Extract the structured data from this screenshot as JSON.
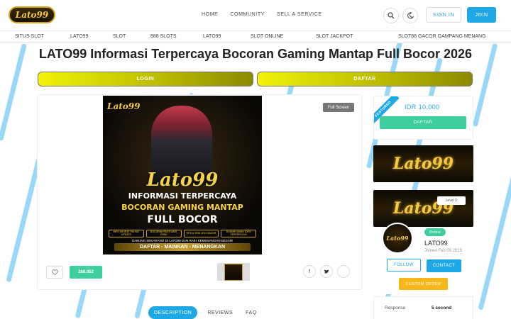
{
  "header": {
    "logo_text": "Lato99",
    "nav": [
      "HOME",
      "COMMUNITY",
      "SELL A SERVICE"
    ],
    "search_icon": "search-icon",
    "theme_icon": "moon-icon",
    "signin_label": "SIGN IN",
    "join_label": "JOIN"
  },
  "subnav": [
    "SITUS SLOT",
    "LATO99",
    "SLOT",
    "888 SLOTS",
    "LATO99",
    "SLOT ONLINE",
    "SLOT JACKPOT",
    "SLOT88 GACOR GAMPANG MENANG"
  ],
  "page_title": "LATO99 Informasi Terpercaya Bocoran Gaming Mantap Full Bocor 2026",
  "buttons": {
    "login": "LOGIN",
    "daftar": "DAFTAR"
  },
  "banner": {
    "logo": "Lato99",
    "big": "Lato99",
    "line1": "INFORMASI TERPERCAYA",
    "line2": "BOCORAN GAMING MANTAP",
    "line3": "FULL BOCOR",
    "features": [
      "INFO AKURAT PALING UPDATE",
      "BOCORAN PASTI ANTI ZONK",
      "TIPS & TRIK JITU GACOR",
      "DIJAMIN AMAN 100% TERPERCAYA"
    ],
    "sub": "GABUNG SEKARANG DI LATO99 DAN RAIH KEMENANGAN BESAR!",
    "cta": "DAFTAR - MAINKAN - MENANGKAN"
  },
  "fullscreen_label": "Full Screen",
  "likes_count": "268.652",
  "tabs": [
    "DESCRIPTION",
    "REVIEWS",
    "FAQ"
  ],
  "sidebar": {
    "ribbon": "FEATURED",
    "price": "IDR 10.000",
    "daftar_label": "DAFTAR",
    "logo_text": "Lato99",
    "level": "Level X",
    "avatar_text": "Lato99",
    "online": "Online",
    "name": "LATO99",
    "joined": "Joined Feb 05 2015",
    "follow": "FOLLOW",
    "contact": "CONTACT",
    "custom_order": "CUSTOM ORDER",
    "response_label": "Response",
    "response_value": "5 second"
  },
  "colors": {
    "accent": "#1ea8e6",
    "green": "#3ecf9c",
    "gold": "#f5c842",
    "orange": "#f5b818"
  }
}
